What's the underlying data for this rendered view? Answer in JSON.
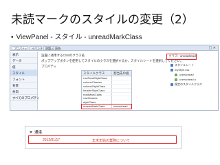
{
  "slide": {
    "title": "未読マークのスタイルの変更（2）",
    "bullet": "ViewPanel - スタイル - unreadMarkClass"
  },
  "panel": {
    "tabs": [
      "プロパティ",
      "イベント",
      "問題 (0 項目)"
    ],
    "window_icons": "□ ✕",
    "sidebar": [
      "表示",
      "データ",
      "値",
      "スタイル",
      "フォント",
      "背景",
      "余白",
      "すべてのプロパティ"
    ],
    "selected_sidebar_index": 3,
    "info": [
      "設置に適用するCSSのクラス名",
      "ポップアップボタンを使用してスタイルのクラスを選択するか、スタイルシートを選択してください。",
      "プロパティ"
    ],
    "grid": {
      "columns": [
        "スタイルクラス",
        "割当先の値"
      ],
      "rows": [
        {
          "name": "rowReadStyleClass",
          "value": ""
        },
        {
          "name": "columnClasses",
          "value": ""
        },
        {
          "name": "columnStyleClass",
          "value": ""
        },
        {
          "name": "headerStyleClass",
          "value": ""
        },
        {
          "name": "readMarkClass",
          "value": ""
        },
        {
          "name": "rowClasses",
          "value": ""
        },
        {
          "name": "styleClass",
          "value": ""
        },
        {
          "name": "unreadMarkClass",
          "value": "unreadread"
        }
      ],
      "highlight_index": 7
    },
    "value_box": {
      "label": "クラス:",
      "value": "unreadread"
    },
    "tree": [
      {
        "label": "スタイルシート",
        "level": 1
      },
      {
        "label": "myStyle.css",
        "level": 1
      },
      {
        "label": ".unreadread",
        "level": 2
      },
      {
        "label": ".unreadread a",
        "level": 2
      },
      {
        "label": "既定のスタイルクラス",
        "level": 1
      }
    ]
  },
  "preview": {
    "title": "通達",
    "date": "2012/01/17",
    "subject": "年末年始の業務について"
  },
  "colors": {
    "highlight": "#e0282e",
    "unread_text": "#d33c2a",
    "selected_bg": "#cfe0f5"
  }
}
